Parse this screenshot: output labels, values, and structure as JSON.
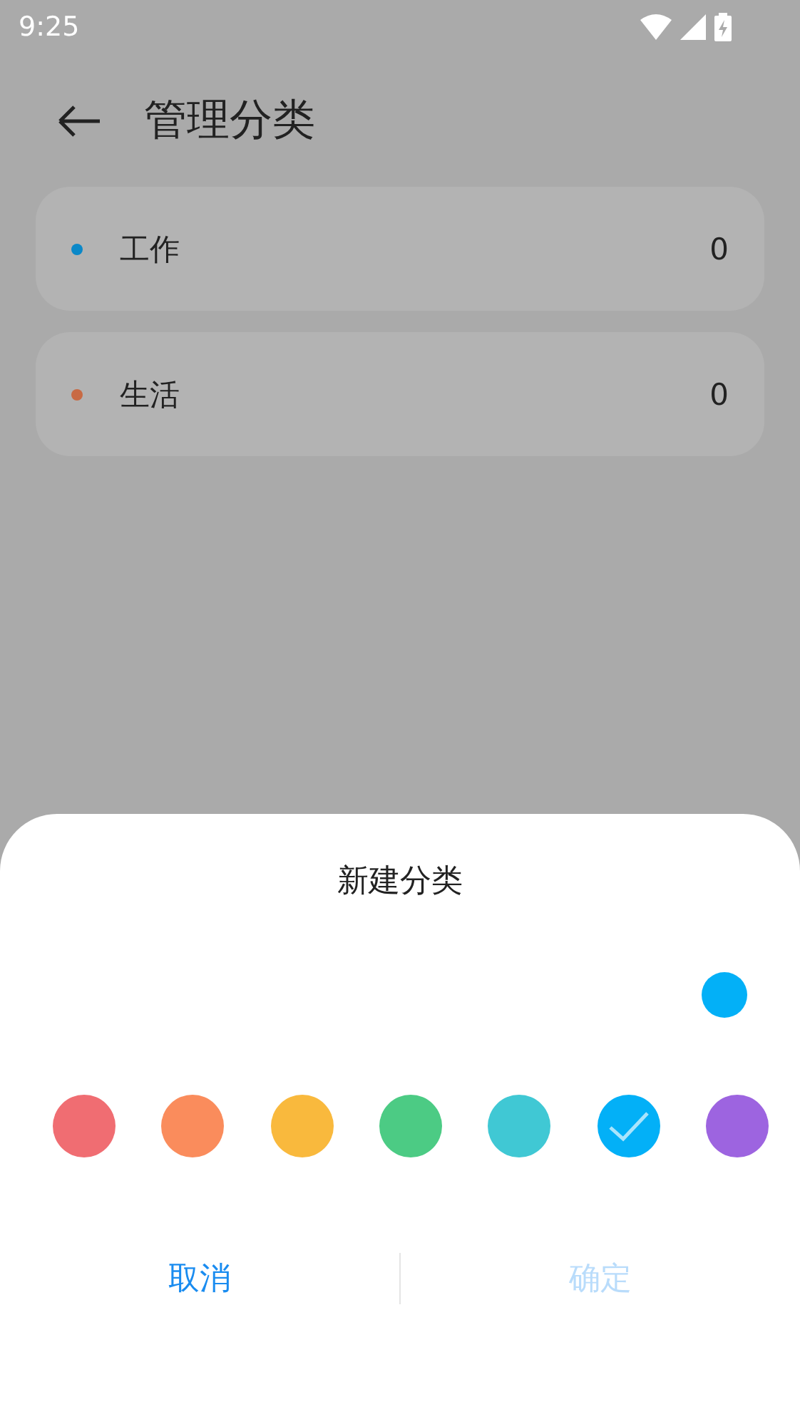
{
  "status_bar": {
    "time": "9:25"
  },
  "header": {
    "title": "管理分类"
  },
  "categories": [
    {
      "name": "工作",
      "count": "0",
      "color": "#0a88c8"
    },
    {
      "name": "生活",
      "count": "0",
      "color": "#c86a44"
    }
  ],
  "dialog": {
    "title": "新建分类",
    "swatches": [
      {
        "color": "#f06d72",
        "selected": false
      },
      {
        "color": "#fa8c5c",
        "selected": false
      },
      {
        "color": "#f9b93d",
        "selected": false
      },
      {
        "color": "#4ccb84",
        "selected": false
      },
      {
        "color": "#40c8d4",
        "selected": false
      },
      {
        "color": "#03b0f7",
        "selected": true
      },
      {
        "color": "#9d64e0",
        "selected": false
      }
    ],
    "buttons": [
      {
        "label": "取消",
        "disabled": false
      },
      {
        "label": "确定",
        "disabled": true
      }
    ]
  }
}
